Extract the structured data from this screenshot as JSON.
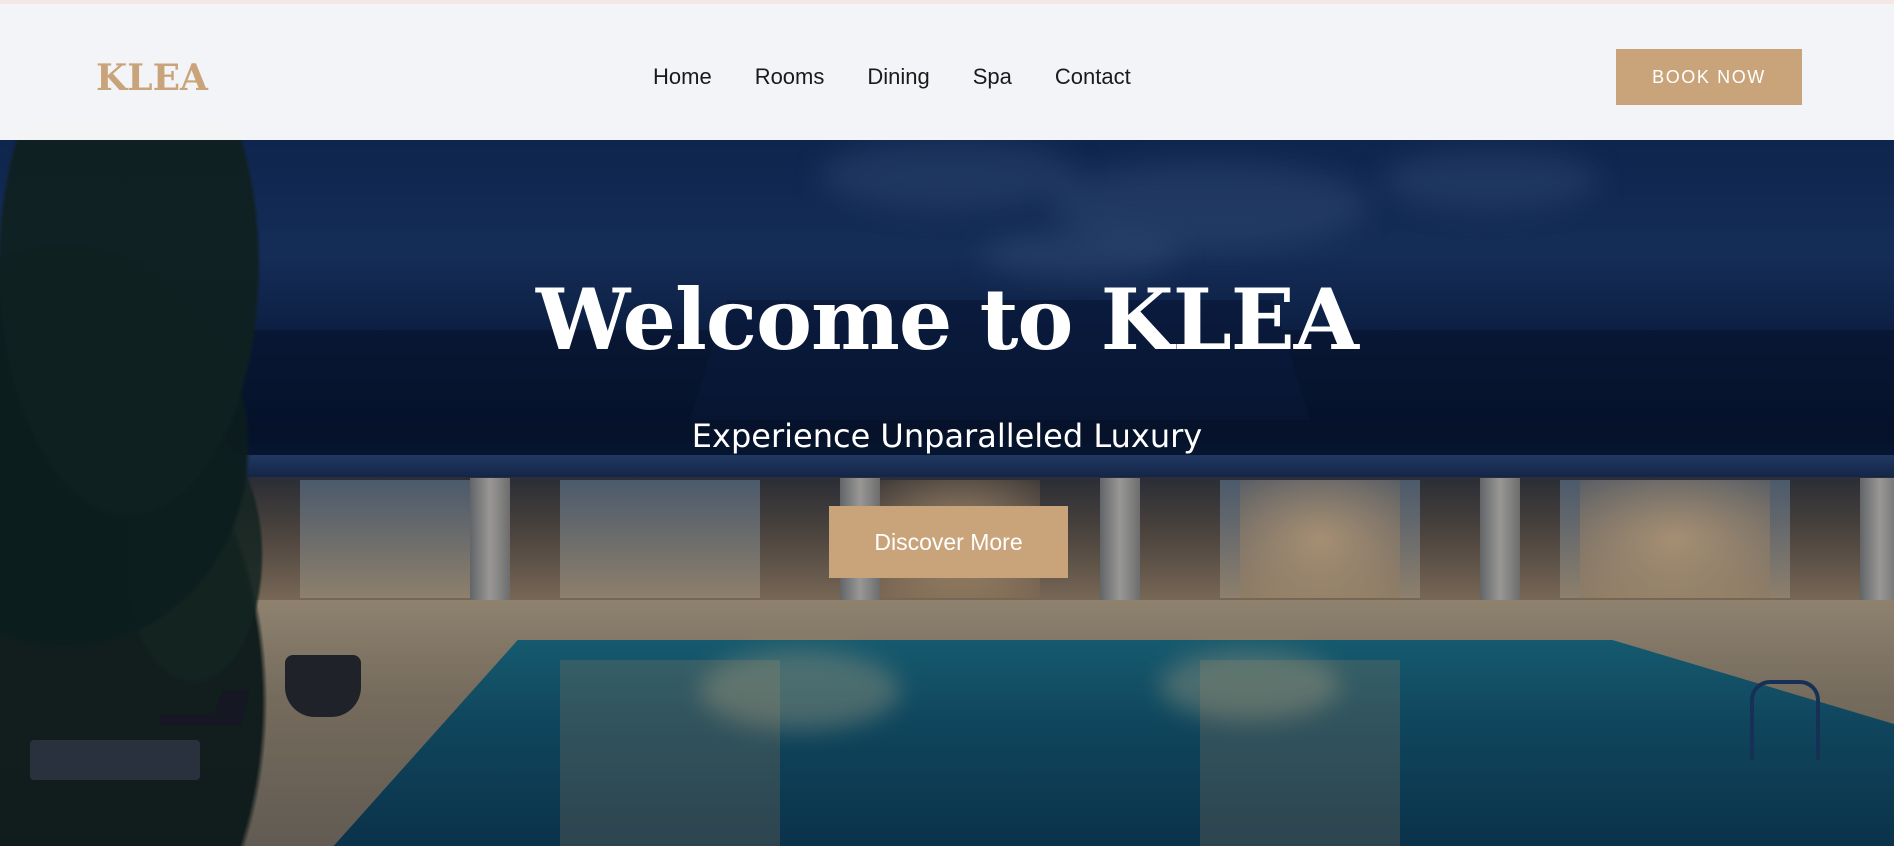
{
  "brand": {
    "logo_text": "KLEA",
    "accent_color": "#c9a47a"
  },
  "nav": {
    "items": [
      {
        "label": "Home"
      },
      {
        "label": "Rooms"
      },
      {
        "label": "Dining"
      },
      {
        "label": "Spa"
      },
      {
        "label": "Contact"
      }
    ]
  },
  "header": {
    "cta_label": "BOOK NOW"
  },
  "hero": {
    "title": "Welcome to KLEA",
    "subtitle": "Experience Unparalleled Luxury",
    "cta_label": "Discover More"
  }
}
